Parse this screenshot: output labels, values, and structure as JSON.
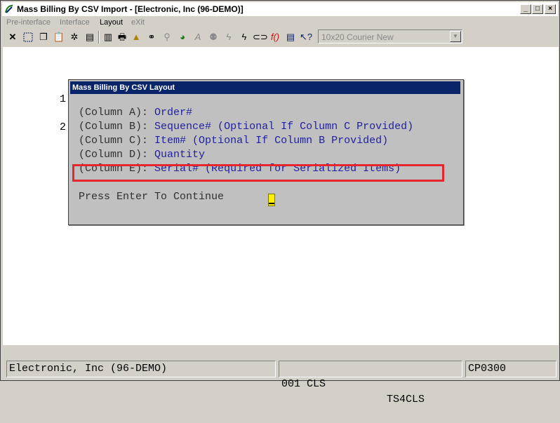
{
  "window": {
    "title": "Mass Billing By CSV Import - [Electronic, Inc (96-DEMO)]"
  },
  "title_buttons": {
    "minimize": "_",
    "maximize": "□",
    "close": "×"
  },
  "menu": {
    "items": [
      {
        "label": "Pre-interface",
        "enabled": false
      },
      {
        "label": "Interface",
        "enabled": false
      },
      {
        "label": "Layout",
        "enabled": true
      },
      {
        "label": "eXit",
        "enabled": false
      }
    ]
  },
  "toolbar": {
    "font_select": "10x20 Courier New"
  },
  "background": {
    "line1": "1",
    "line2": "2"
  },
  "dialog": {
    "title": "Mass Billing By CSV Layout",
    "rows": [
      {
        "label": "(Column A):",
        "value": "Order#"
      },
      {
        "label": "(Column B):",
        "value": "Sequence# (Optional If Column C Provided)"
      },
      {
        "label": "(Column C):",
        "value": "Item# (Optional If Column B Provided)"
      },
      {
        "label": "(Column D):",
        "value": "Quantity"
      },
      {
        "label": "(Column E):",
        "value": "Serial# (Required for Serialized Items)"
      }
    ],
    "prompt": "Press Enter To Continue"
  },
  "status": {
    "company": "Electronic, Inc (96-DEMO)",
    "code": "001 CLS",
    "terminal": "TS4CLS",
    "program": "CP0300"
  }
}
